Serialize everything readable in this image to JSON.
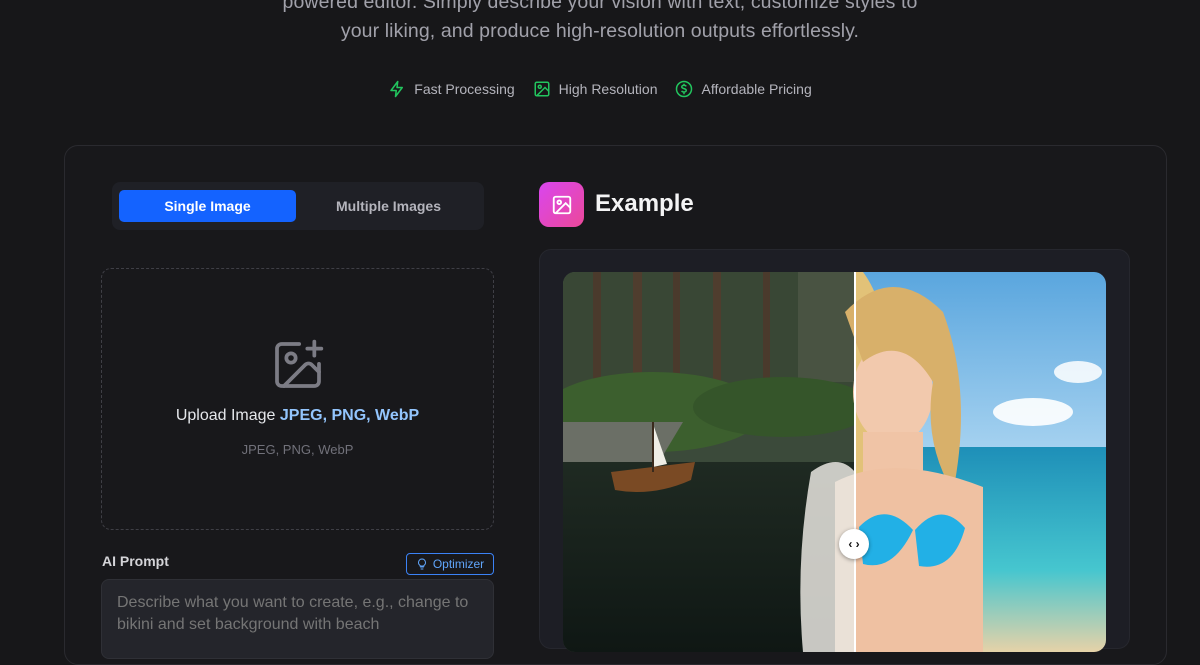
{
  "hero": {
    "description_line1": "powered editor. Simply describe your vision with text, customize styles to",
    "description_line2": "your liking, and produce high-resolution outputs effortlessly."
  },
  "features": [
    {
      "label": "Fast Processing",
      "icon": "lightning-icon"
    },
    {
      "label": "High Resolution",
      "icon": "image-icon"
    },
    {
      "label": "Affordable Pricing",
      "icon": "dollar-circle-icon"
    }
  ],
  "tabs": [
    {
      "label": "Single Image",
      "active": true
    },
    {
      "label": "Multiple Images",
      "active": false
    }
  ],
  "upload": {
    "title": "Upload Image",
    "formats_highlight": "JPEG, PNG, WebP",
    "formats_sub": "JPEG, PNG, WebP"
  },
  "prompt": {
    "label": "AI Prompt",
    "optimizer_label": "Optimizer",
    "placeholder": "Describe what you want to create, e.g., change to bikini and set background with beach"
  },
  "example": {
    "title": "Example",
    "handle_glyph": "‹ ›"
  },
  "colors": {
    "accent": "#1463ff",
    "feature_icon": "#22c55e",
    "example_gradient_start": "#d946ef",
    "example_gradient_end": "#ec4899"
  }
}
